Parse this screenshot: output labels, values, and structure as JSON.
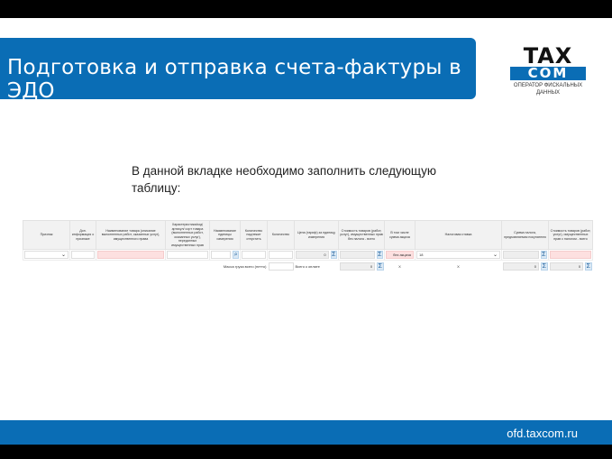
{
  "slide": {
    "title": "Подготовка и отправка счета-фактуры в ЭДО",
    "intro": "В данной вкладке необходимо заполнить следующую таблицу:",
    "url": "ofd.taxcom.ru"
  },
  "logo": {
    "line1": "TAX",
    "line2": "COM",
    "tagline": "ОПЕРАТОР ФИСКАЛЬНЫХ ДАННЫХ"
  },
  "colors": {
    "brand_blue": "#0a6db5"
  },
  "table": {
    "headers": [
      "Признак",
      "Доп. информация о признаке",
      "Наименование товара (описание выполненных работ, оказанных услуг), имущественного права",
      "Характеристика/код/ артикул/ сорт товара (выполненных работ, оказанных услуг), переданных имущественных прав",
      "Наименование единицы измерения",
      "Количество надлежит отпустить",
      "Количество",
      "Цена (тариф) за единицу измерения",
      "Стоимость товаров (работ, услуг), имущественных прав без налога - всего",
      "В том числе сумма акциза",
      "Налоговая ставка",
      "Сумма налога, предъявляемая покупателю",
      "Стоимость товаров (работ, услуг), имущественных прав с налогом - всего"
    ],
    "row": {
      "price": "0",
      "excise": "без акциза",
      "tax_rate": "18"
    },
    "footer": {
      "mass_label": "Масса груза всего (нетто)",
      "total_label": "Всего к оплате",
      "sum_no_tax": "0",
      "excise": "Х",
      "tax_rate": "Х",
      "tax_sum": "0",
      "sum_with_tax": "0"
    }
  }
}
